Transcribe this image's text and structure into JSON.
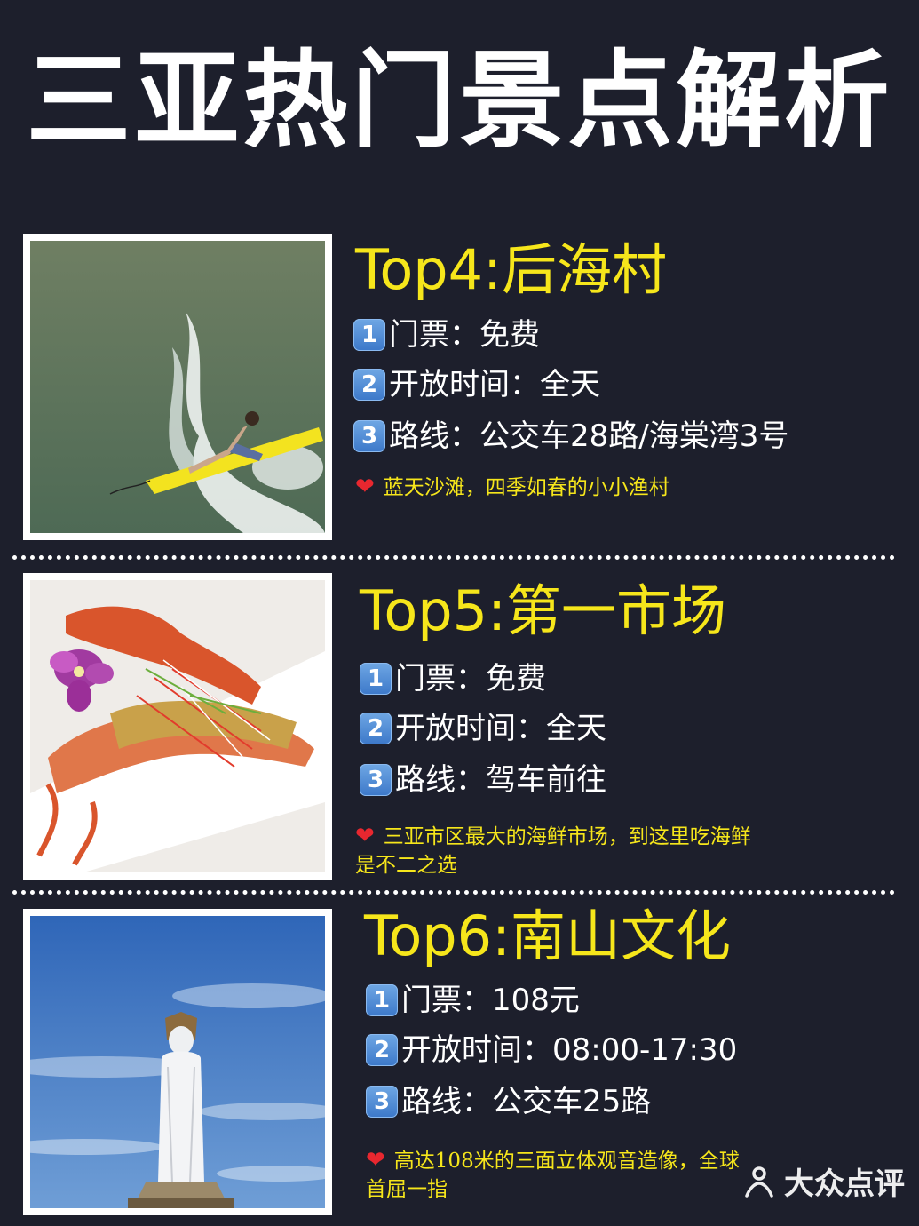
{
  "header": {
    "title": "三亚热门景点解析"
  },
  "spots": [
    {
      "title": "Top4:后海村",
      "items": [
        {
          "num": "1",
          "text": "门票：免费"
        },
        {
          "num": "2",
          "text": "开放时间：全天"
        },
        {
          "num": "3",
          "text": "路线：公交车28路/海棠湾3号"
        }
      ],
      "note_line1": "蓝天沙滩，四季如春的小小渔村",
      "note_line2": "",
      "photo_icon": "surfer-photo"
    },
    {
      "title": "Top5:第一市场",
      "items": [
        {
          "num": "1",
          "text": "门票：免费"
        },
        {
          "num": "2",
          "text": "开放时间：全天"
        },
        {
          "num": "3",
          "text": "路线：驾车前往"
        }
      ],
      "note_line1": "三亚市区最大的海鲜市场，到这里吃海鲜",
      "note_line2": "是不二之选",
      "photo_icon": "seafood-photo"
    },
    {
      "title": "Top6:南山文化",
      "items": [
        {
          "num": "1",
          "text": "门票：108元"
        },
        {
          "num": "2",
          "text": "开放时间：08:00-17:30"
        },
        {
          "num": "3",
          "text": "路线：公交车25路"
        }
      ],
      "note_line1": "高达108米的三面立体观音造像，全球",
      "note_line2": "首屈一指",
      "photo_icon": "guanyin-statue-photo"
    }
  ],
  "watermark": {
    "text": "大众点评"
  },
  "colors": {
    "background": "#1d1f2c",
    "accent": "#f6e61b",
    "heart": "#e8272f",
    "badge": "#4a86d4"
  }
}
